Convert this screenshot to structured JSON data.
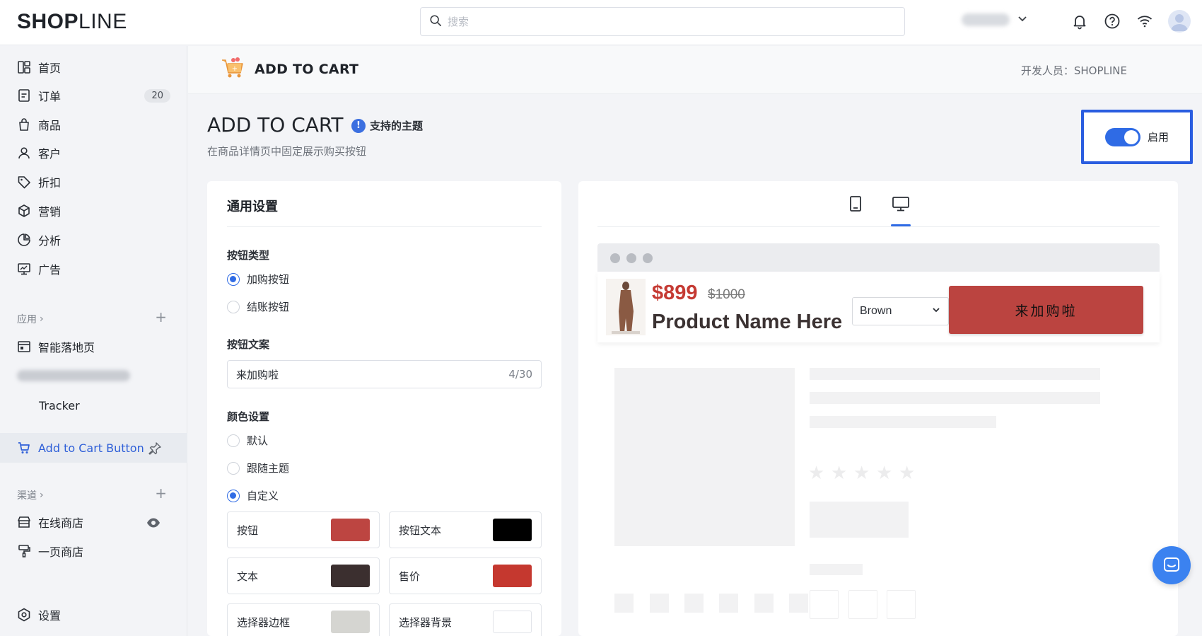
{
  "brand": {
    "logo_text_bold": "SHOP",
    "logo_text_thin": "LINE"
  },
  "topbar": {
    "search_placeholder": "搜索",
    "icons": [
      "search-icon",
      "chevron-down-icon",
      "bell-icon",
      "help-icon",
      "wifi-icon",
      "avatar"
    ]
  },
  "sidebar": {
    "items": [
      {
        "label": "首页",
        "icon": "dashboard-icon"
      },
      {
        "label": "订单",
        "icon": "order-icon",
        "badge": "20"
      },
      {
        "label": "商品",
        "icon": "bag-icon"
      },
      {
        "label": "客户",
        "icon": "user-icon"
      },
      {
        "label": "折扣",
        "icon": "tag-icon"
      },
      {
        "label": "营销",
        "icon": "cube-icon"
      },
      {
        "label": "分析",
        "icon": "pie-chart-icon"
      },
      {
        "label": "广告",
        "icon": "monitor-icon"
      }
    ],
    "apps_heading": "应用",
    "apps": [
      {
        "label": "智能落地页",
        "icon": "layout-icon"
      },
      {
        "label": "Tracker"
      },
      {
        "label": "Add to Cart Button",
        "icon": "cart-icon",
        "active": true
      }
    ],
    "channels_heading": "渠道",
    "channels": [
      {
        "label": "在线商店",
        "icon": "store-icon"
      },
      {
        "label": "一页商店",
        "icon": "brush-icon"
      }
    ],
    "settings_label": "设置"
  },
  "app_header": {
    "title": "ADD TO CART",
    "developer": "开发人员：SHOPLINE"
  },
  "page": {
    "title": "ADD TO CART",
    "themes_link": "支持的主题",
    "subtitle": "在商品详情页中固定展示购买按钮",
    "enable_label": "启用",
    "enabled": true
  },
  "settings": {
    "card_title": "通用设置",
    "button_type_label": "按钮类型",
    "button_types": [
      {
        "label": "加购按钮",
        "selected": true
      },
      {
        "label": "结账按钮",
        "selected": false
      }
    ],
    "button_text_label": "按钮文案",
    "button_text_value": "来加购啦",
    "button_text_counter": "4/30",
    "color_label": "颜色设置",
    "color_modes": [
      {
        "label": "默认",
        "selected": false
      },
      {
        "label": "跟随主题",
        "selected": false
      },
      {
        "label": "自定义",
        "selected": true
      }
    ],
    "colors": [
      {
        "label": "按钮",
        "value": "#bd4541"
      },
      {
        "label": "按钮文本",
        "value": "#000000"
      },
      {
        "label": "文本",
        "value": "#3b2f2f"
      },
      {
        "label": "售价",
        "value": "#c5382f"
      },
      {
        "label": "选择器边框",
        "value": "#d5d5d1"
      },
      {
        "label": "选择器背景",
        "value": "#ffffff"
      }
    ]
  },
  "preview": {
    "devices": [
      "tablet-icon",
      "desktop-icon"
    ],
    "selected_device": "desktop",
    "price": "$899",
    "original_price": "$1000",
    "product_name": "Product Name Here",
    "variant_value": "Brown",
    "buy_button_label": "来加购啦"
  }
}
